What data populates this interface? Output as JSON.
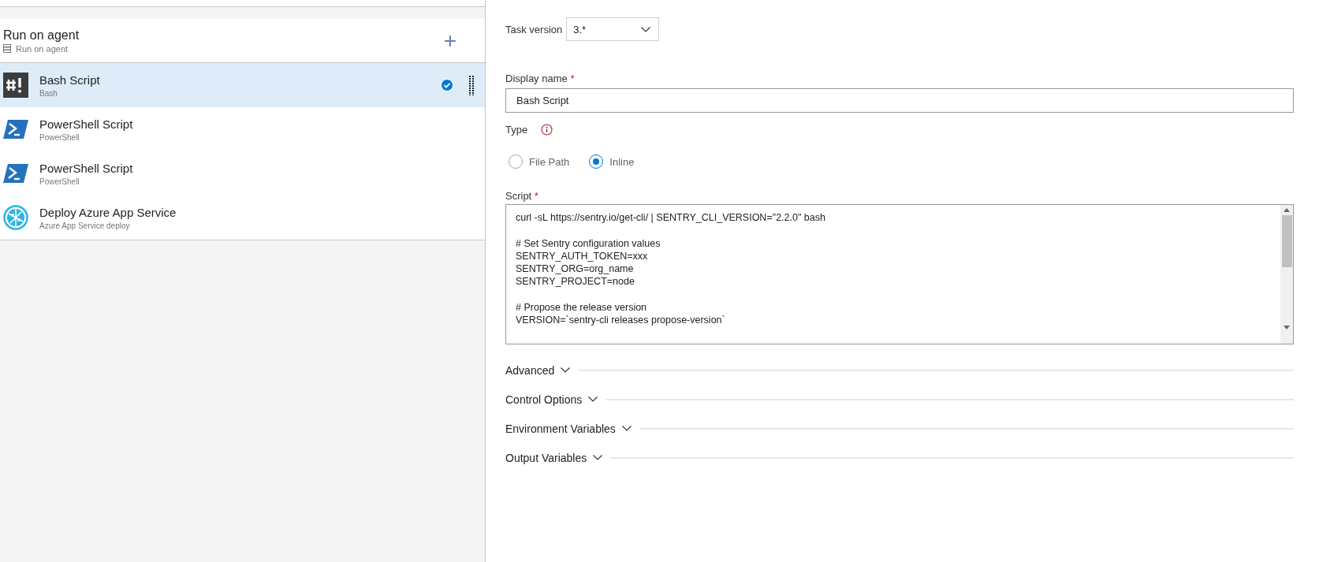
{
  "phase": {
    "title": "Run on agent",
    "subtitle": "Run on agent",
    "add_label": "+"
  },
  "tasks": [
    {
      "kind": "bash",
      "name": "Bash Script",
      "subtitle": "Bash",
      "selected": true
    },
    {
      "kind": "powershell",
      "name": "PowerShell Script",
      "subtitle": "PowerShell",
      "selected": false
    },
    {
      "kind": "powershell",
      "name": "PowerShell Script",
      "subtitle": "PowerShell",
      "selected": false
    },
    {
      "kind": "azure",
      "name": "Deploy Azure App Service",
      "subtitle": "Azure App Service deploy",
      "selected": false
    }
  ],
  "task_version": {
    "label": "Task version",
    "value": "3.*"
  },
  "display_name": {
    "label": "Display name",
    "required_mark": "*",
    "value": "Bash Script"
  },
  "type": {
    "label": "Type",
    "options": [
      {
        "label": "File Path",
        "selected": false
      },
      {
        "label": "Inline",
        "selected": true
      }
    ]
  },
  "script": {
    "label": "Script",
    "required_mark": "*",
    "blocks": [
      [
        "curl -sL https://sentry.io/get-cli/ | SENTRY_CLI_VERSION=\"2.2.0\" bash"
      ],
      [
        "# Set Sentry configuration values",
        "SENTRY_AUTH_TOKEN=xxx",
        "SENTRY_ORG=org_name",
        "SENTRY_PROJECT=node"
      ],
      [
        "# Propose the release version",
        "VERSION=`sentry-cli releases propose-version`"
      ]
    ]
  },
  "sections": [
    {
      "label": "Advanced",
      "expanded": false
    },
    {
      "label": "Control Options",
      "expanded": false
    },
    {
      "label": "Environment Variables",
      "expanded": false
    },
    {
      "label": "Output Variables",
      "expanded": false
    }
  ]
}
